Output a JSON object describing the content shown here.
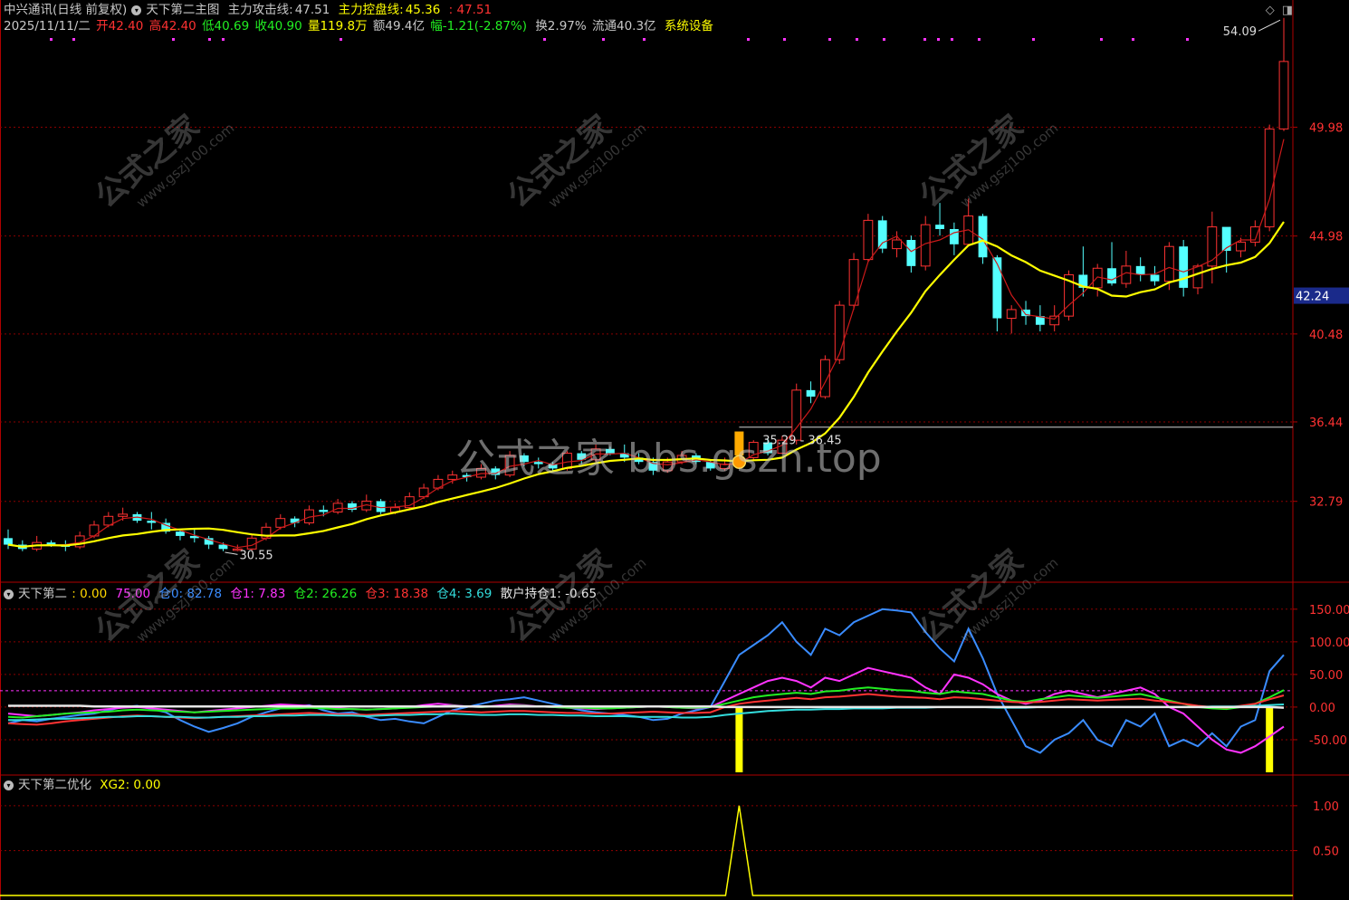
{
  "header": {
    "stock_name": "中兴通讯(日线 前复权)",
    "indicator_name": "天下第二主图",
    "attack_label": "主力攻击线:",
    "attack_value": "47.51",
    "control_label": "主力控盘线:",
    "control_value": "45.36",
    "extra_value": ": 47.51"
  },
  "quote": {
    "date": "2025/11/11/二",
    "open": "开42.40",
    "high": "高42.40",
    "low": "低40.69",
    "close": "收40.90",
    "volume": "量119.8万",
    "amount": "额49.4亿",
    "change": "幅-1.21(-2.87%)",
    "turnover": "换2.97%",
    "float_cap": "流通40.3亿",
    "sector": "系统设备"
  },
  "pane2": {
    "title": "天下第二",
    "items": [
      {
        "text": ": 0.00",
        "color": "#ffd800"
      },
      {
        "text": "75.00",
        "color": "#ff33ff"
      },
      {
        "text": "仓0: 82.78",
        "color": "#3a8cff"
      },
      {
        "text": "仓1: 7.83",
        "color": "#ff33ff"
      },
      {
        "text": "仓2: 26.26",
        "color": "#22ee22"
      },
      {
        "text": "仓3: 18.38",
        "color": "#ff3333"
      },
      {
        "text": "仓4: 3.69",
        "color": "#33dddd"
      },
      {
        "text": "散户持仓1: -0.65",
        "color": "#e8e8e8"
      }
    ]
  },
  "pane3": {
    "title": "天下第二优化",
    "xg": "XG2: 0.00"
  },
  "watermark": {
    "main": "公式之家 bbs.gszh.top",
    "small_cn": "公式之家",
    "small_url": "www.gszj100.com"
  },
  "annotations": {
    "max_label": "54.09",
    "min_label": "30.55",
    "range_label": "35.29 - 36.45",
    "current_price": "42.24"
  },
  "colors": {
    "up": "#ff3232",
    "down": "#54ffff",
    "ma_yellow": "#ffff00",
    "ma_red": "#ff2020",
    "grid": "#8b0000",
    "axis_text": "#ff3232"
  },
  "chart_data": [
    {
      "type": "candlestick",
      "title": "天下第二主图",
      "y_ticks": [
        32.79,
        36.44,
        40.48,
        44.98,
        49.98
      ],
      "ylim": [
        29.2,
        55.2
      ],
      "grid": true,
      "candles": [
        [
          31.1,
          31.5,
          30.6,
          30.8
        ],
        [
          30.8,
          31.0,
          30.5,
          30.6
        ],
        [
          30.6,
          31.2,
          30.5,
          30.9
        ],
        [
          30.9,
          31.0,
          30.7,
          30.8
        ],
        [
          30.8,
          31.0,
          30.5,
          30.7
        ],
        [
          30.7,
          31.4,
          30.6,
          31.2
        ],
        [
          31.2,
          31.9,
          31.1,
          31.7
        ],
        [
          31.7,
          32.3,
          31.6,
          32.1
        ],
        [
          32.1,
          32.5,
          31.9,
          32.2
        ],
        [
          32.2,
          32.3,
          31.8,
          31.9
        ],
        [
          31.9,
          32.3,
          31.5,
          31.8
        ],
        [
          31.8,
          32.0,
          31.3,
          31.4
        ],
        [
          31.4,
          31.5,
          31.0,
          31.2
        ],
        [
          31.2,
          31.5,
          30.9,
          31.1
        ],
        [
          31.1,
          31.2,
          30.6,
          30.8
        ],
        [
          30.8,
          30.9,
          30.5,
          30.6
        ],
        [
          30.6,
          30.8,
          30.5,
          30.6
        ],
        [
          30.6,
          31.3,
          30.5,
          31.1
        ],
        [
          31.1,
          31.8,
          31.0,
          31.6
        ],
        [
          31.6,
          32.2,
          31.5,
          32.0
        ],
        [
          32.0,
          32.1,
          31.6,
          31.8
        ],
        [
          31.8,
          32.6,
          31.7,
          32.4
        ],
        [
          32.4,
          32.6,
          32.1,
          32.3
        ],
        [
          32.3,
          32.9,
          32.2,
          32.7
        ],
        [
          32.7,
          32.8,
          32.3,
          32.4
        ],
        [
          32.4,
          33.1,
          32.3,
          32.8
        ],
        [
          32.8,
          32.9,
          32.2,
          32.3
        ],
        [
          32.3,
          32.7,
          32.2,
          32.5
        ],
        [
          32.5,
          33.2,
          32.4,
          33.0
        ],
        [
          33.0,
          33.6,
          32.9,
          33.4
        ],
        [
          33.4,
          34.0,
          33.3,
          33.8
        ],
        [
          33.8,
          34.2,
          33.6,
          34.0
        ],
        [
          34.0,
          34.1,
          33.7,
          33.9
        ],
        [
          33.9,
          34.5,
          33.8,
          34.3
        ],
        [
          34.3,
          34.4,
          33.8,
          34.0
        ],
        [
          34.0,
          35.1,
          33.9,
          34.9
        ],
        [
          34.9,
          35.0,
          34.4,
          34.6
        ],
        [
          34.6,
          34.8,
          34.3,
          34.5
        ],
        [
          34.5,
          34.6,
          34.2,
          34.3
        ],
        [
          34.3,
          35.1,
          34.2,
          35.0
        ],
        [
          35.0,
          35.1,
          34.5,
          34.7
        ],
        [
          34.7,
          35.4,
          34.6,
          35.2
        ],
        [
          35.2,
          35.3,
          34.9,
          35.0
        ],
        [
          35.0,
          35.4,
          34.6,
          34.8
        ],
        [
          34.8,
          35.0,
          34.5,
          34.6
        ],
        [
          34.6,
          34.8,
          34.0,
          34.2
        ],
        [
          34.2,
          34.8,
          34.1,
          34.6
        ],
        [
          34.6,
          35.1,
          34.5,
          34.9
        ],
        [
          34.9,
          35.0,
          34.5,
          34.6
        ],
        [
          34.6,
          34.7,
          34.2,
          34.3
        ],
        [
          34.3,
          34.8,
          34.2,
          34.5
        ],
        [
          34.5,
          35.0,
          34.4,
          34.8
        ],
        [
          34.8,
          35.6,
          34.7,
          35.5
        ],
        [
          35.5,
          35.7,
          34.9,
          35.0
        ],
        [
          35.0,
          35.8,
          35.0,
          35.6
        ],
        [
          35.6,
          38.2,
          35.4,
          37.9
        ],
        [
          37.9,
          38.3,
          37.3,
          37.6
        ],
        [
          37.6,
          39.5,
          37.5,
          39.3
        ],
        [
          39.3,
          42.0,
          39.1,
          41.8
        ],
        [
          41.8,
          44.2,
          41.6,
          43.9
        ],
        [
          43.9,
          46.0,
          43.8,
          45.7
        ],
        [
          45.7,
          45.9,
          44.2,
          44.4
        ],
        [
          44.4,
          45.2,
          44.0,
          44.8
        ],
        [
          44.8,
          45.0,
          43.3,
          43.6
        ],
        [
          43.6,
          45.9,
          43.4,
          45.5
        ],
        [
          45.5,
          46.5,
          45.0,
          45.3
        ],
        [
          45.3,
          45.6,
          44.1,
          44.6
        ],
        [
          44.6,
          46.7,
          44.5,
          45.9
        ],
        [
          45.9,
          46.0,
          43.7,
          44.0
        ],
        [
          44.0,
          44.1,
          40.6,
          41.2
        ],
        [
          41.2,
          41.8,
          40.5,
          41.6
        ],
        [
          41.6,
          42.0,
          40.9,
          41.3
        ],
        [
          41.3,
          41.8,
          40.6,
          40.9
        ],
        [
          40.9,
          41.8,
          40.6,
          41.3
        ],
        [
          41.3,
          43.4,
          41.1,
          43.2
        ],
        [
          43.2,
          44.5,
          42.2,
          42.6
        ],
        [
          42.6,
          43.7,
          42.2,
          43.5
        ],
        [
          43.5,
          44.7,
          42.7,
          42.8
        ],
        [
          42.8,
          44.3,
          42.6,
          43.6
        ],
        [
          43.6,
          44.0,
          42.9,
          43.2
        ],
        [
          43.2,
          43.6,
          42.7,
          42.9
        ],
        [
          42.9,
          44.7,
          42.5,
          44.5
        ],
        [
          44.5,
          44.8,
          42.2,
          42.6
        ],
        [
          42.6,
          43.7,
          42.3,
          43.6
        ],
        [
          43.6,
          46.1,
          42.8,
          45.4
        ],
        [
          45.4,
          44.9,
          43.3,
          44.3
        ],
        [
          44.3,
          44.9,
          44.0,
          44.7
        ],
        [
          44.7,
          45.7,
          44.5,
          45.4
        ],
        [
          45.4,
          50.1,
          45.2,
          49.9
        ],
        [
          49.9,
          55.0,
          49.8,
          53.0
        ]
      ]
    },
    {
      "type": "line",
      "title": "天下第二",
      "y_ticks": [
        150.0,
        100.0,
        50.0,
        0.0,
        -50.0
      ],
      "ylim": [
        -100,
        165
      ],
      "series": [
        {
          "name": "仓0",
          "color": "#3a8cff",
          "values": [
            -25,
            -20,
            -22,
            -18,
            -15,
            -12,
            -10,
            -5,
            0,
            2,
            -3,
            -8,
            -20,
            -30,
            -38,
            -32,
            -25,
            -15,
            -8,
            -2,
            0,
            3,
            -5,
            -10,
            -8,
            -15,
            -20,
            -18,
            -22,
            -25,
            -15,
            -5,
            0,
            5,
            10,
            12,
            15,
            10,
            5,
            0,
            -5,
            -8,
            -10,
            -12,
            -15,
            -20,
            -18,
            -10,
            -5,
            0,
            40,
            80,
            95,
            110,
            130,
            100,
            80,
            120,
            110,
            130,
            140,
            150,
            148,
            145,
            115,
            90,
            70,
            120,
            75,
            20,
            -20,
            -60,
            -70,
            -50,
            -40,
            -20,
            -50,
            -60,
            -20,
            -30,
            -10,
            -60,
            -50,
            -60,
            -40,
            -60,
            -30,
            -20,
            55,
            80
          ]
        },
        {
          "name": "仓1",
          "color": "#ff33ff",
          "values": [
            -10,
            -12,
            -14,
            -12,
            -10,
            -8,
            -5,
            -3,
            -1,
            0,
            -2,
            -4,
            -6,
            -8,
            -6,
            -4,
            -2,
            0,
            2,
            4,
            3,
            2,
            0,
            -2,
            -3,
            -4,
            -3,
            -2,
            0,
            3,
            5,
            3,
            1,
            0,
            2,
            4,
            3,
            1,
            0,
            -1,
            -2,
            -3,
            -2,
            -1,
            0,
            1,
            0,
            -1,
            -2,
            0,
            10,
            20,
            30,
            40,
            45,
            40,
            30,
            45,
            40,
            50,
            60,
            55,
            50,
            45,
            30,
            20,
            50,
            45,
            35,
            20,
            10,
            5,
            10,
            20,
            25,
            20,
            15,
            20,
            25,
            30,
            20,
            0,
            -10,
            -30,
            -50,
            -65,
            -70,
            -60,
            -45,
            -30
          ]
        },
        {
          "name": "仓2",
          "color": "#22ee22",
          "values": [
            -15,
            -16,
            -14,
            -12,
            -10,
            -9,
            -8,
            -7,
            -5,
            -4,
            -5,
            -6,
            -7,
            -8,
            -7,
            -6,
            -5,
            -4,
            -3,
            -2,
            -2,
            -1,
            -2,
            -3,
            -3,
            -4,
            -3,
            -2,
            -1,
            0,
            1,
            2,
            1,
            0,
            1,
            2,
            2,
            1,
            0,
            -1,
            -1,
            -2,
            -2,
            -1,
            0,
            1,
            0,
            -1,
            -1,
            0,
            5,
            10,
            15,
            18,
            20,
            22,
            20,
            24,
            25,
            28,
            30,
            28,
            26,
            25,
            22,
            20,
            24,
            22,
            20,
            15,
            10,
            8,
            12,
            15,
            18,
            16,
            14,
            16,
            18,
            20,
            15,
            10,
            5,
            0,
            -2,
            -3,
            0,
            5,
            15,
            26
          ]
        },
        {
          "name": "仓3",
          "color": "#ff3333",
          "values": [
            -25,
            -26,
            -27,
            -25,
            -22,
            -20,
            -18,
            -16,
            -14,
            -13,
            -14,
            -15,
            -16,
            -17,
            -16,
            -15,
            -14,
            -13,
            -12,
            -11,
            -10,
            -9,
            -10,
            -11,
            -11,
            -12,
            -11,
            -10,
            -9,
            -8,
            -7,
            -6,
            -7,
            -8,
            -7,
            -6,
            -6,
            -7,
            -8,
            -9,
            -9,
            -10,
            -10,
            -9,
            -8,
            -7,
            -8,
            -9,
            -9,
            -8,
            0,
            5,
            8,
            10,
            12,
            14,
            12,
            15,
            16,
            18,
            20,
            18,
            16,
            15,
            14,
            12,
            15,
            14,
            12,
            10,
            8,
            7,
            8,
            10,
            12,
            11,
            10,
            11,
            12,
            13,
            10,
            8,
            5,
            2,
            0,
            -1,
            2,
            5,
            12,
            18
          ]
        },
        {
          "name": "仓4",
          "color": "#33dddd",
          "values": [
            -20,
            -20,
            -19,
            -18,
            -18,
            -17,
            -16,
            -15,
            -15,
            -14,
            -14,
            -15,
            -15,
            -16,
            -16,
            -15,
            -15,
            -14,
            -14,
            -13,
            -13,
            -12,
            -12,
            -13,
            -13,
            -14,
            -13,
            -12,
            -12,
            -11,
            -11,
            -10,
            -11,
            -12,
            -12,
            -11,
            -11,
            -12,
            -12,
            -13,
            -13,
            -14,
            -14,
            -14,
            -15,
            -15,
            -15,
            -16,
            -16,
            -15,
            -12,
            -10,
            -8,
            -6,
            -5,
            -4,
            -4,
            -3,
            -3,
            -2,
            -2,
            -2,
            -1,
            -1,
            -1,
            0,
            0,
            0,
            0,
            -1,
            -1,
            -1,
            0,
            0,
            0,
            0,
            0,
            0,
            0,
            0,
            0,
            0,
            0,
            0,
            1,
            1,
            1,
            2,
            3,
            4
          ]
        },
        {
          "name": "散户持仓1",
          "color": "#e8e8e8",
          "values": [
            2,
            2,
            2,
            2,
            2,
            2,
            1,
            1,
            1,
            1,
            1,
            1,
            1,
            1,
            1,
            1,
            1,
            1,
            1,
            1,
            1,
            1,
            1,
            1,
            1,
            1,
            1,
            1,
            1,
            1,
            1,
            1,
            1,
            1,
            1,
            1,
            1,
            1,
            1,
            1,
            1,
            1,
            1,
            1,
            1,
            1,
            1,
            1,
            1,
            1,
            0,
            0,
            0,
            0,
            0,
            0,
            0,
            0,
            0,
            0,
            0,
            0,
            0,
            0,
            0,
            0,
            0,
            0,
            0,
            0,
            0,
            0,
            0,
            0,
            0,
            0,
            0,
            0,
            0,
            0,
            0,
            0,
            0,
            0,
            0,
            0,
            0,
            0,
            0,
            -1
          ]
        }
      ],
      "signal_bars_index": [
        51,
        88
      ]
    },
    {
      "type": "line",
      "title": "天下第二优化",
      "y_ticks": [
        1.0,
        0.5
      ],
      "ylim": [
        -0.05,
        1.2
      ],
      "series": [
        {
          "name": "XG2",
          "color": "#ffff00",
          "spike_index": 51,
          "spike_value": 1.0
        }
      ]
    }
  ]
}
